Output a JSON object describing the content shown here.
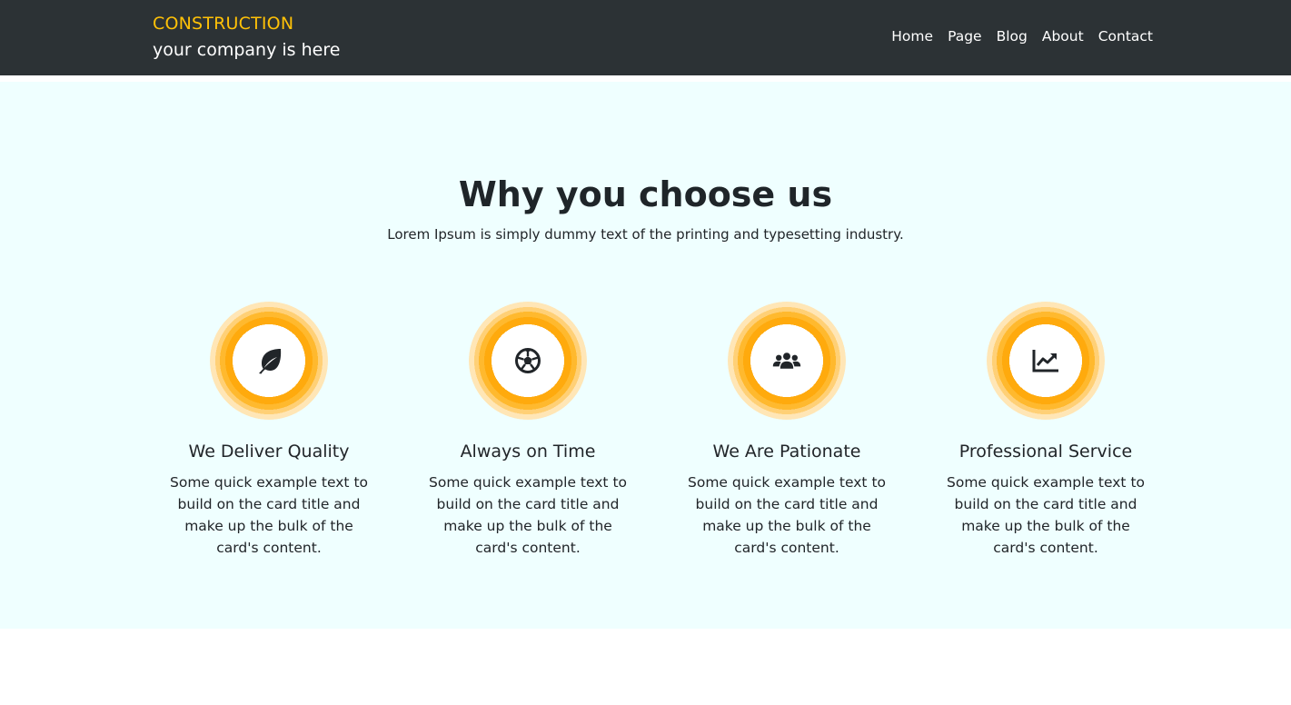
{
  "header": {
    "brand_name": "CONSTRUCTION",
    "tagline": "your company is here",
    "nav": [
      "Home",
      "Page",
      "Blog",
      "About",
      "Contact"
    ]
  },
  "section": {
    "title": "Why you choose us",
    "subtitle": "Lorem Ipsum is simply dummy text of the printing and typesetting industry.",
    "cards": [
      {
        "icon": "leaf-icon",
        "title": "We Deliver Quality",
        "text": "Some quick example text to build on the card title and make up the bulk of the card's content."
      },
      {
        "icon": "soccer-ball-icon",
        "title": "Always on Time",
        "text": "Some quick example text to build on the card title and make up the bulk of the card's content."
      },
      {
        "icon": "users-icon",
        "title": "We Are Pationate",
        "text": "Some quick example text to build on the card title and make up the bulk of the card's content."
      },
      {
        "icon": "chart-line-icon",
        "title": "Professional Service",
        "text": "Some quick example text to build on the card title and make up the bulk of the card's content."
      }
    ]
  },
  "colors": {
    "header_bg": "#2c3235",
    "brand_accent": "#ffc107",
    "section_bg": "#efffff",
    "icon_ring": "#ffaa0d",
    "text": "#212529"
  }
}
